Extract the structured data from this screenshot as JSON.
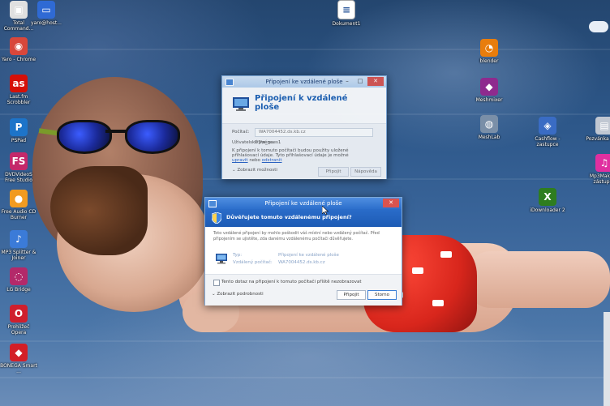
{
  "desktop": {
    "icons_left": [
      {
        "label": "Total Command...",
        "color": "#e0e0e0",
        "glyph": "▣"
      },
      {
        "label": "Yaro - Chrome",
        "color": "#d8473b",
        "glyph": "◉"
      },
      {
        "label": "Last.fm Scrobbler",
        "color": "#d51007",
        "glyph": "as"
      },
      {
        "label": "PSPad",
        "color": "#1d74c9",
        "glyph": "P"
      },
      {
        "label": "DVDVideoS Free Studio",
        "color": "#c4286a",
        "glyph": "FS"
      },
      {
        "label": "Free Audio CD Burner",
        "color": "#f19b21",
        "glyph": "●"
      },
      {
        "label": "MP3 Splitter & Joiner",
        "color": "#3b7bd8",
        "glyph": "♪"
      },
      {
        "label": "LG Bridge",
        "color": "#b3296a",
        "glyph": "◌"
      },
      {
        "label": "Prohlížeč Opera",
        "color": "#cf1f2d",
        "glyph": "O"
      },
      {
        "label": "BONEGA Smart ...",
        "color": "#d31f27",
        "glyph": "◆"
      }
    ],
    "icon_top_second": {
      "label": "yaro@host..."
    },
    "icon_document": {
      "label": "Dokument1"
    },
    "icons_right": [
      {
        "label": "blender",
        "color": "#e87d0d",
        "glyph": "◔"
      },
      {
        "label": "Meshmixer",
        "color": "#8e2a8e",
        "glyph": "◆"
      },
      {
        "label": "MeshLab",
        "color": "#7a8fa8",
        "glyph": "◍"
      },
      {
        "label": "Cashflow - zastupce",
        "color": "#3a6cc4",
        "glyph": "◈"
      },
      {
        "label": "iDownloader 2",
        "color": "#2e7d1f",
        "glyph": "X"
      },
      {
        "label": "Pozvánka na ...",
        "color": "#c0c7d2",
        "glyph": "▤"
      },
      {
        "label": "Mp3Maker... zástupce",
        "color": "#e02fa0",
        "glyph": "♫"
      }
    ]
  },
  "rdp_main": {
    "title": "Připojení ke vzdálené ploše",
    "heading": "Připojení k vzdálené ploše",
    "computer_label": "Počítač:",
    "computer_value": "WA7004452.ds.kb.cz",
    "user_label": "Uživatelské jméno:",
    "user_value": "DS\\e_gaes1",
    "info_text": "K připojení k tomuto počítači budou použity uložené přihlašovací údaje. Tyto přihlašovací údaje je možné",
    "info_link_edit": "upravit",
    "info_link_delete": "odstranit",
    "info_conj": "nebo",
    "show_options": "Zobrazit možnosti",
    "connect_button": "Připojit",
    "help_button": "Nápověda"
  },
  "rdp_trust": {
    "title": "Připojení ke vzdálené ploše",
    "question": "Důvěřujete tomuto vzdálenému připojení?",
    "description": "Toto vzdálené připojení by mohlo poškodit váš místní nebo vzdálený počítač. Před připojením se ujistěte, zda danému vzdálenému počítači důvěřujete.",
    "type_label": "Typ:",
    "type_value": "Připojení ke vzdálené ploše",
    "remote_label": "Vzdálený počítač:",
    "remote_value": "WA7004452.ds.kb.cz",
    "checkbox_label": "Tento dotaz na připojení k tomuto počítači příště nezobrazovat",
    "details_toggle": "Zobrazit podrobnosti",
    "connect_button": "Připojit",
    "cancel_button": "Storno"
  }
}
